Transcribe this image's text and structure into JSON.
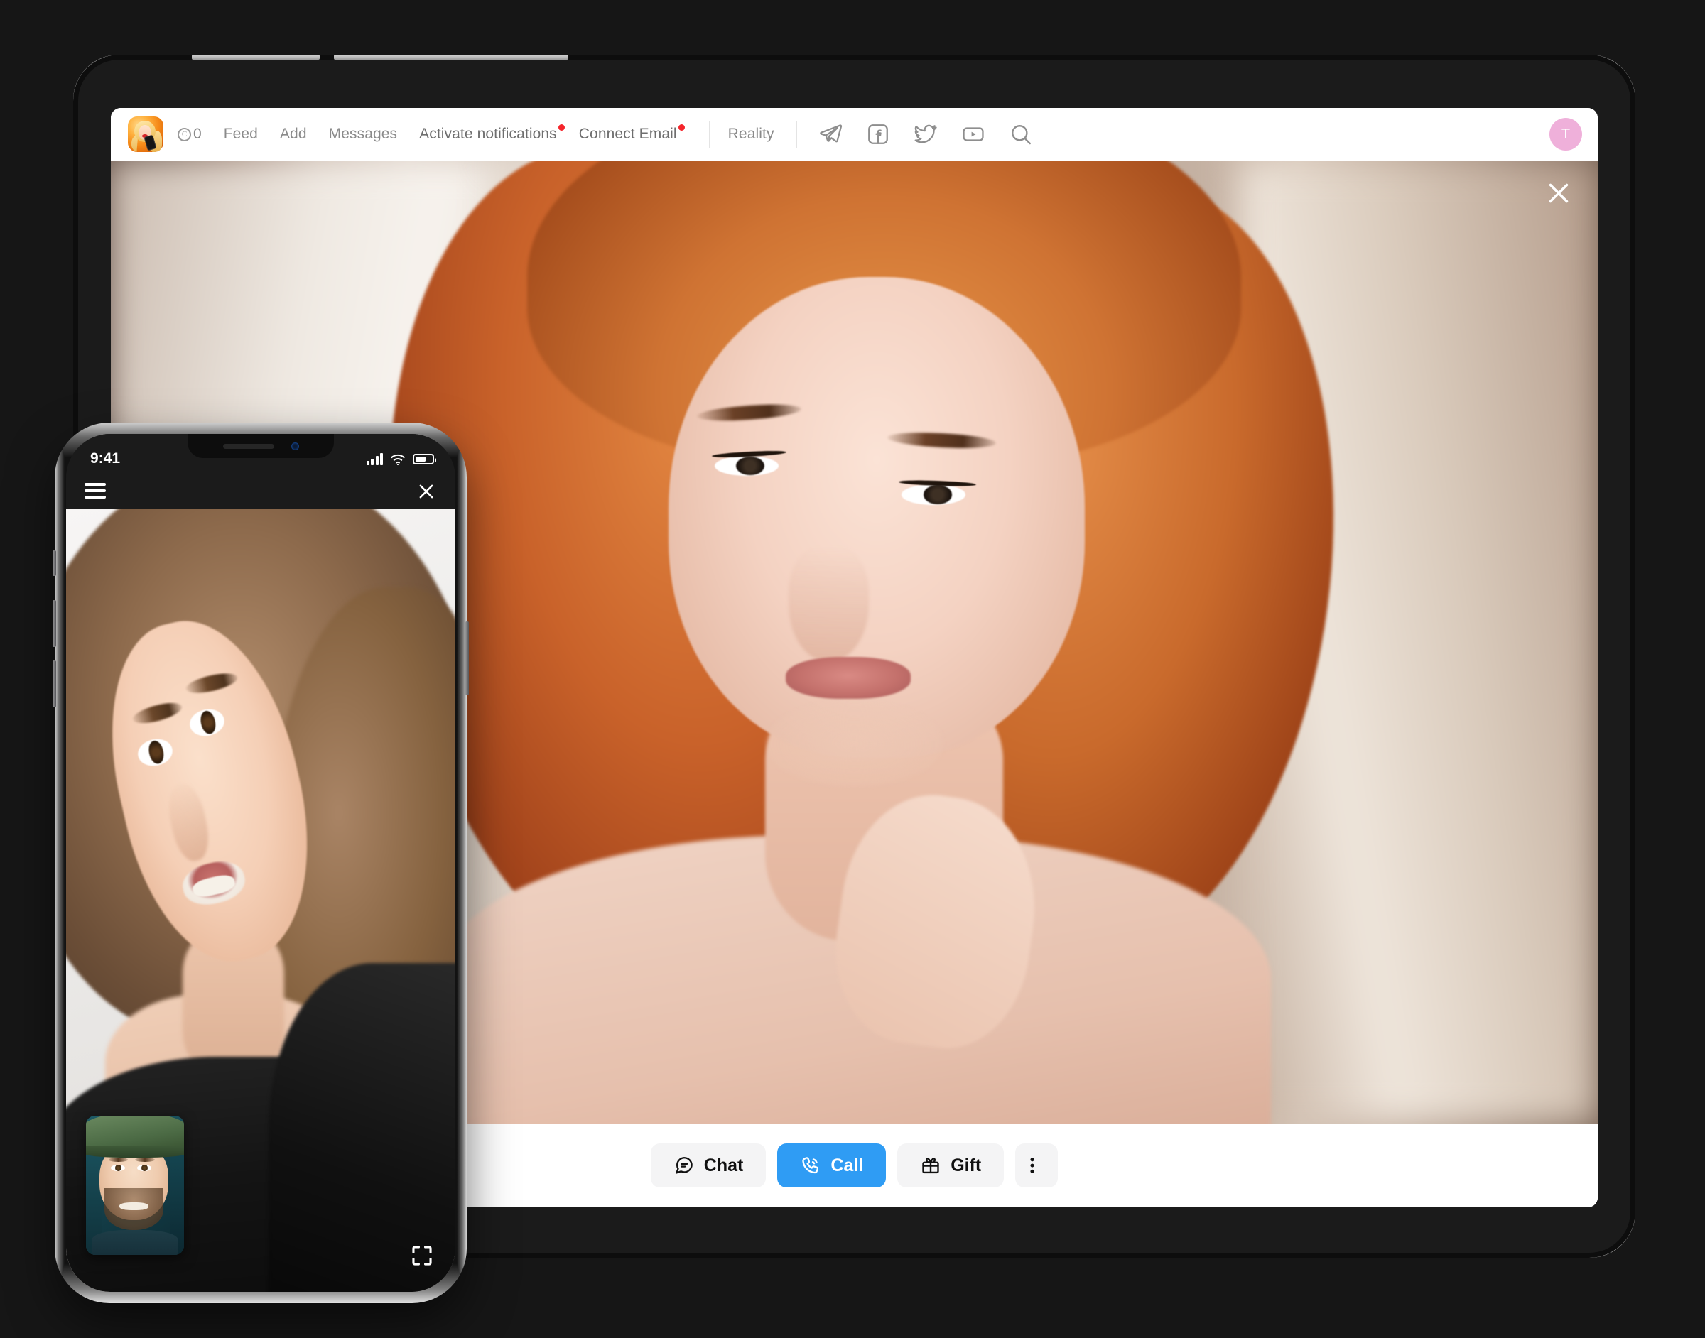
{
  "background_color": "#161616",
  "tablet": {
    "nav": {
      "logo_icon": "app-logo-woman-phone",
      "coins": {
        "icon": "coin-icon",
        "symbol": "C",
        "value": "0"
      },
      "links": [
        {
          "label": "Feed",
          "badge": false
        },
        {
          "label": "Add",
          "badge": false
        },
        {
          "label": "Messages",
          "badge": false
        },
        {
          "label": "Activate notifications",
          "badge": true
        },
        {
          "label": "Connect Email",
          "badge": true
        }
      ],
      "reality_label": "Reality",
      "social_icons": [
        "telegram-icon",
        "facebook-icon",
        "twitter-icon",
        "youtube-icon",
        "search-icon"
      ],
      "avatar": {
        "initial": "T",
        "color": "#efb0da"
      },
      "badge_color": "#f5262c"
    },
    "viewer": {
      "close_icon": "close-icon",
      "subject": "red-haired-woman-portrait"
    },
    "actions": [
      {
        "label": "Chat",
        "icon": "chat-bubble-icon",
        "primary": false
      },
      {
        "label": "Call",
        "icon": "phone-call-icon",
        "primary": true
      },
      {
        "label": "Gift",
        "icon": "gift-icon",
        "primary": false
      },
      {
        "label": "",
        "icon": "more-vertical-icon",
        "primary": false
      }
    ],
    "accent_color": "#2f9cf4"
  },
  "phone": {
    "status_bar": {
      "time": "9:41",
      "signal_icon": "cellular-bars-icon",
      "wifi_icon": "wifi-icon",
      "battery_icon": "battery-icon"
    },
    "top_bar": {
      "menu_icon": "hamburger-menu-icon",
      "close_icon": "close-icon"
    },
    "video_call": {
      "main_subject": "smiling-brunette-woman",
      "pip_subject": "man-with-green-cap",
      "expand_icon": "fullscreen-expand-icon"
    }
  }
}
